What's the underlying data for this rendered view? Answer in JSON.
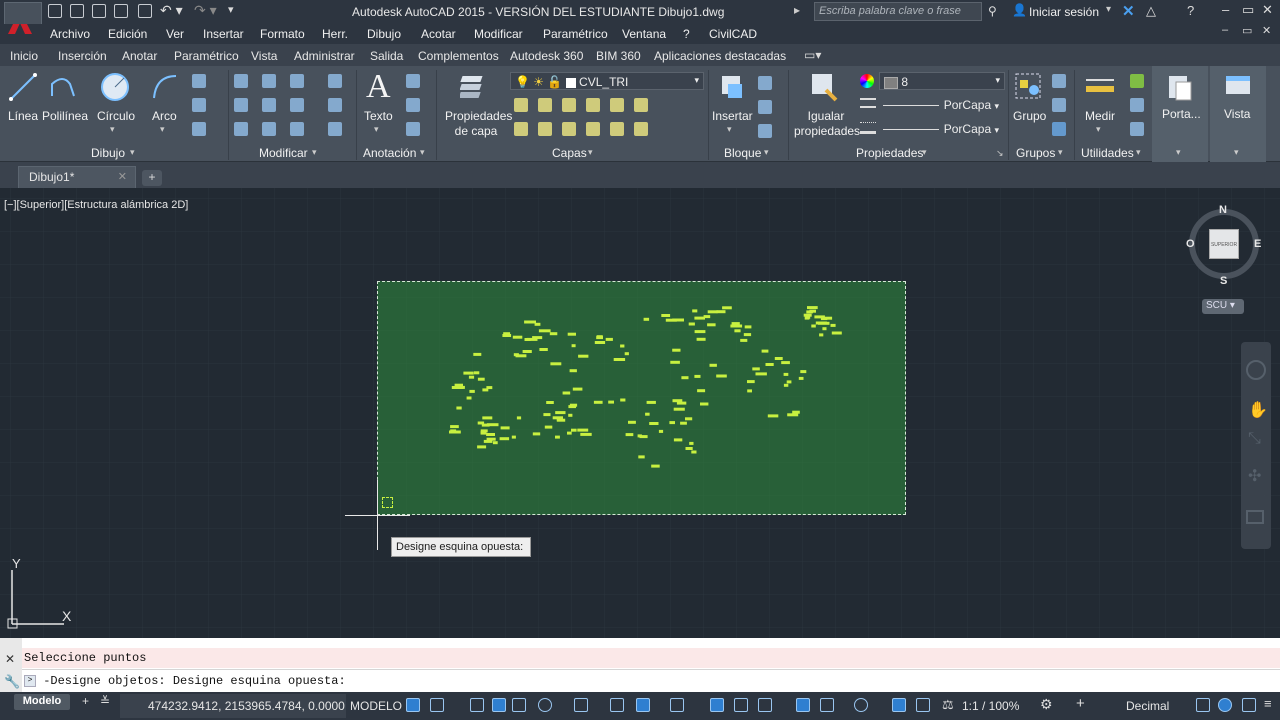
{
  "title_bar": {
    "title": "Autodesk AutoCAD 2015 - VERSIÓN DEL ESTUDIANTE   Dibujo1.dwg",
    "search_placeholder": "Escriba palabra clave o frase",
    "signin": "Iniciar sesión"
  },
  "menu": [
    "Archivo",
    "Edición",
    "Ver",
    "Insertar",
    "Formato",
    "Herr.",
    "Dibujo",
    "Acotar",
    "Modificar",
    "Paramétrico",
    "Ventana",
    "?",
    "CivilCAD"
  ],
  "ribbon_tabs": [
    "Inicio",
    "Inserción",
    "Anotar",
    "Paramétrico",
    "Vista",
    "Administrar",
    "Salida",
    "Complementos",
    "Autodesk 360",
    "BIM 360",
    "Aplicaciones destacadas"
  ],
  "ribbon": {
    "draw": {
      "line": "Línea",
      "polyline": "Polilínea",
      "circle": "Círculo",
      "arc": "Arco",
      "panel": "Dibujo"
    },
    "modify": {
      "panel": "Modificar"
    },
    "annotation": {
      "text": "Texto",
      "panel": "Anotación"
    },
    "layers": {
      "properties": "Propiedades de capa",
      "current": "CVL_TRI",
      "panel": "Capas"
    },
    "block": {
      "insert": "Insertar",
      "panel": "Bloque"
    },
    "properties": {
      "match": "Igualar propiedades",
      "color": "8",
      "linetype": "PorCapa",
      "lineweight": "PorCapa",
      "panel": "Propiedades"
    },
    "groups": {
      "group": "Grupo",
      "panel": "Grupos"
    },
    "utilities": {
      "measure": "Medir",
      "panel": "Utilidades"
    },
    "clipboard": {
      "label": "Porta..."
    },
    "view": {
      "label": "Vista"
    }
  },
  "doc_tab": {
    "name": "Dibujo1*"
  },
  "viewport": {
    "label": "[−][Superior][Estructura alámbrica 2D]"
  },
  "viewcube": {
    "n": "N",
    "s": "S",
    "e": "E",
    "o": "O",
    "face": "SUPERIOR",
    "ucs": "SCU"
  },
  "tooltip": "Designe esquina opuesta:",
  "ucs_icon": {
    "x": "X",
    "y": "Y"
  },
  "command_line": {
    "history": "Seleccione puntos",
    "current": "-Designe objetos: Designe esquina opuesta:"
  },
  "status_bar": {
    "model_tab": "Modelo",
    "coordinates": "474232.9412, 2153965.4784, 0.0000",
    "space": "MODELO",
    "scale": "1:1 / 100%",
    "units": "Decimal"
  },
  "colors": {
    "point_marks": "#c8f040",
    "selection_fill": "#2e8c3c",
    "canvas": "#222a33"
  }
}
